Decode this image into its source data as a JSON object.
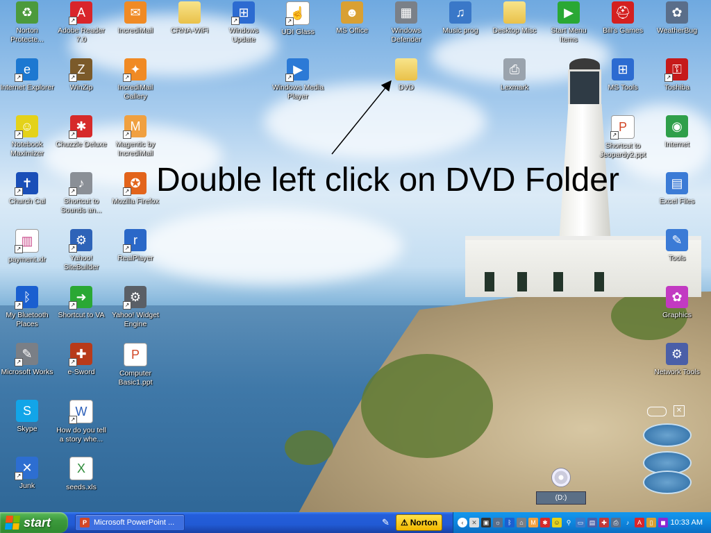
{
  "annotation": "Double left click on DVD Folder",
  "desktop_icons": [
    {
      "label": "Norton Protecte...",
      "icon": "norton-recycle-icon",
      "color": "#4c9a3c"
    },
    {
      "label": "Adobe Reader 7.0",
      "icon": "adobe-reader-icon",
      "color": "#d9252a"
    },
    {
      "label": "IncrediMail",
      "icon": "incredimail-icon",
      "color": "#f08a24"
    },
    {
      "label": "CRNA-WiFi",
      "icon": "folder-icon",
      "color": "#e9c14a"
    },
    {
      "label": "Windows Update",
      "icon": "windows-update-icon",
      "color": "#2c6bd1"
    },
    {
      "label": "UDI Glass",
      "icon": "cursor-doc-icon",
      "color": "#ffffff"
    },
    {
      "label": "MS Office",
      "icon": "ms-office-icon",
      "color": "#d9a033"
    },
    {
      "label": "Windows Defender",
      "icon": "wall-icon",
      "color": "#7a8088"
    },
    {
      "label": "Music prog",
      "icon": "music-icon",
      "color": "#3a78c8"
    },
    {
      "label": "Desktop Misc",
      "icon": "folder-icon",
      "color": "#e9c14a"
    },
    {
      "label": "Start Menu Items",
      "icon": "play-icon",
      "color": "#2aa834"
    },
    {
      "label": "Bill's Games",
      "icon": "helmet-icon",
      "color": "#d42020"
    },
    {
      "label": "WeatherBug",
      "icon": "weatherbug-icon",
      "color": "#5a6e8a"
    },
    {
      "label": "Internet Explorer",
      "icon": "ie-icon",
      "color": "#1d78d1"
    },
    {
      "label": "WinZip",
      "icon": "winzip-icon",
      "color": "#7b5a2a"
    },
    {
      "label": "IncrediMail Gallery",
      "icon": "gallery-icon",
      "color": "#f08a24"
    },
    {
      "label": "Windows Media Player",
      "icon": "media-player-icon",
      "color": "#2c7ad6"
    },
    {
      "label": "DVD",
      "icon": "folder-icon",
      "color": "#e9c14a"
    },
    {
      "label": "Lexmark",
      "icon": "printer-icon",
      "color": "#9aa3ad"
    },
    {
      "label": "MS Tools",
      "icon": "windows-logo-icon",
      "color": "#2c6bd1"
    },
    {
      "label": "Toshiba",
      "icon": "key-icon",
      "color": "#c61a1a"
    },
    {
      "label": "Notebook Maximizer",
      "icon": "smiley-laptop-icon",
      "color": "#e4d21a"
    },
    {
      "label": "Chuzzle Deluxe",
      "icon": "chuzzle-icon",
      "color": "#d62a2a"
    },
    {
      "label": "Magentic by IncrediMail",
      "icon": "magentic-icon",
      "color": "#f0a040"
    },
    {
      "label": "Shortcut to Jeopardy2.ppt",
      "icon": "ppt-doc-icon",
      "color": "#d24726"
    },
    {
      "label": "Internet",
      "icon": "globe-icon",
      "color": "#2f9f4a"
    },
    {
      "label": "Church Cal",
      "icon": "cross-icon",
      "color": "#1a4fb8"
    },
    {
      "label": "Shortcut to Sounds an...",
      "icon": "speaker-icon",
      "color": "#8a8f96"
    },
    {
      "label": "Mozilla Firefox",
      "icon": "firefox-icon",
      "color": "#e2641b"
    },
    {
      "label": "Excel Files",
      "icon": "spreadsheet-window-icon",
      "color": "#3b7bd6"
    },
    {
      "label": "payment.xlr",
      "icon": "chart-doc-icon",
      "color": "#c94a8a"
    },
    {
      "label": "Yahoo! SiteBuilder",
      "icon": "gear-globe-icon",
      "color": "#2e63b8"
    },
    {
      "label": "RealPlayer",
      "icon": "realplayer-icon",
      "color": "#2a68c8"
    },
    {
      "label": "Tools",
      "icon": "tools-icon",
      "color": "#3b7bd6"
    },
    {
      "label": "My Bluetooth Places",
      "icon": "bluetooth-icon",
      "color": "#1a5fd0"
    },
    {
      "label": "Shortcut to VA",
      "icon": "arrow-icon",
      "color": "#2aa834"
    },
    {
      "label": "Yahoo! Widget Engine",
      "icon": "widget-icon",
      "color": "#5a5f66"
    },
    {
      "label": "Graphics",
      "icon": "graphics-icon",
      "color": "#c23ac2"
    },
    {
      "label": "Microsoft Works",
      "icon": "works-icon",
      "color": "#7a7f86"
    },
    {
      "label": "e-Sword",
      "icon": "bible-icon",
      "color": "#b83a1a"
    },
    {
      "label": "Computer Basic1.ppt",
      "icon": "ppt-doc-icon",
      "color": "#d24726"
    },
    {
      "label": "Network Tools",
      "icon": "network-tools-icon",
      "color": "#4a5fa8"
    },
    {
      "label": "Skype",
      "icon": "skype-icon",
      "color": "#12a5e8"
    },
    {
      "label": "How do you tell a story whe...",
      "icon": "word-doc-icon",
      "color": "#2b5eb8"
    },
    {
      "label": "Junk",
      "icon": "junk-icon",
      "color": "#2d6ed1"
    },
    {
      "label": "seeds.xls",
      "icon": "excel-doc-icon",
      "color": "#2e8b3a"
    }
  ],
  "drive_label": "(D:)",
  "taskbar": {
    "start_label": "start",
    "task_label": "Microsoft PowerPoint ...",
    "norton_label": "Norton",
    "clock": "10:33 AM"
  },
  "colors": {
    "taskbar_blue": "#245edb",
    "start_green": "#3c9a3c",
    "tray_blue": "#0e86de",
    "norton_yellow": "#f2b900"
  }
}
